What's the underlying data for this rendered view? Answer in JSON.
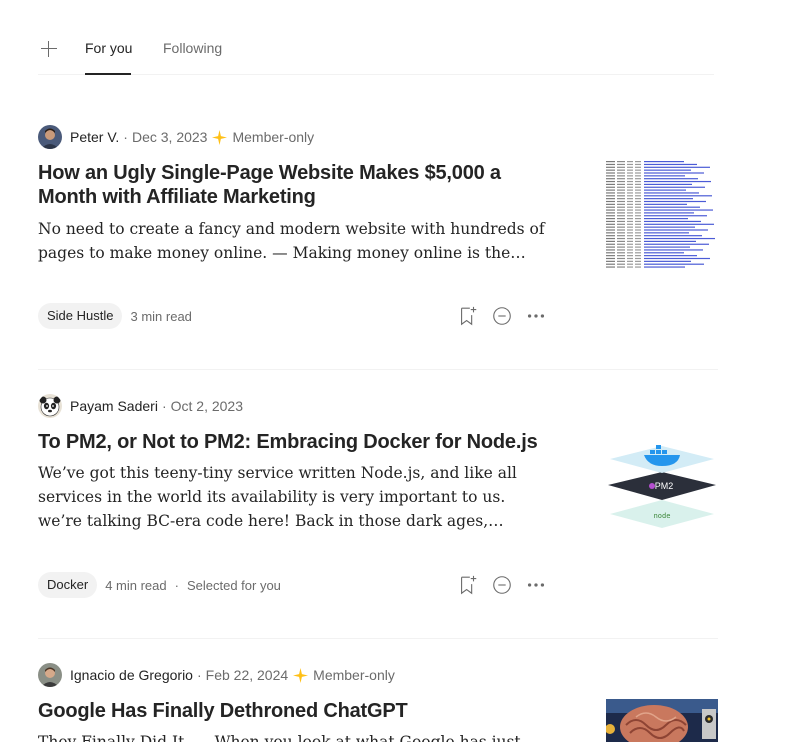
{
  "tabs": {
    "add_label": "+",
    "items": [
      {
        "label": "For you",
        "active": true
      },
      {
        "label": "Following",
        "active": false
      }
    ]
  },
  "articles": [
    {
      "author": "Peter V.",
      "separator": "·",
      "date": "Dec 3, 2023",
      "member_label": "Member-only",
      "title": "How an Ugly Single-Page Website Makes $5,000 a Month with Affiliate Marketing",
      "excerpt": "No need to create a fancy and modern website with hundreds of pages to make money online. — Making money online is the dream for man…",
      "tag": "Side Hustle",
      "read_time": "3 min read",
      "extra": "",
      "thumbnail_icon": "spreadsheet-thumbnail"
    },
    {
      "author": "Payam Saderi",
      "separator": "·",
      "date": "Oct 2, 2023",
      "member_label": "",
      "title": "To PM2, or Not to PM2: Embracing Docker for Node.js",
      "excerpt": "We’ve got this teeny-tiny service written Node.js, and like all services in the world its availability is very important to us. we’re talking BC-era code here! Back in those dark ages, Docker didn’t exist yet. We had to…",
      "tag": "Docker",
      "read_time": "4 min read",
      "extra_sep": "·",
      "extra": "Selected for you",
      "thumbnail_icon": "docker-pm2-node-thumbnail",
      "thumb_label_pm2": "PM2",
      "thumb_label_node": "node"
    },
    {
      "author": "Ignacio de Gregorio",
      "separator": "·",
      "date": "Feb 22, 2024",
      "member_label": "Member-only",
      "title": "Google Has Finally Dethroned ChatGPT",
      "excerpt": "They Finally Did It. — When you look at what Google has just achieved…",
      "thumbnail_icon": "ai-brain-thumbnail"
    }
  ],
  "colors": {
    "text": "#242424",
    "muted": "#6b6b6b",
    "member_star": "#ffc017",
    "pill_bg": "#f2f2f2",
    "divider": "#f2f2f2"
  }
}
